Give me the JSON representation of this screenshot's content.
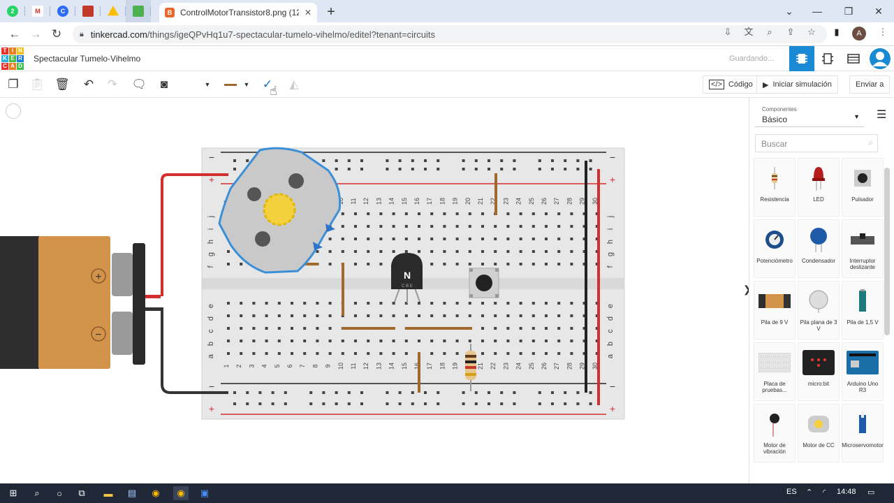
{
  "browser": {
    "active_tab_title": "ControlMotorTransistor8.png (12",
    "url_domain": "tinkercad.com",
    "url_path": "/things/igeQPvHq1u7-spectacular-tumelo-vihelmo/editel?tenant=circuits",
    "avatar_letter": "A",
    "whatsapp_badge": "2"
  },
  "app": {
    "logo_letters": [
      "T",
      "I",
      "N",
      "K",
      "E",
      "R",
      "C",
      "A",
      "D"
    ],
    "project_title": "Spectacular Tumelo-Vihelmo",
    "status": "Guardando..."
  },
  "toolbar": {
    "code_label": "Código",
    "simulate_label": "Iniciar simulación",
    "send_label": "Enviar a"
  },
  "panel": {
    "components_label": "Componentes",
    "components_value": "Básico",
    "search_placeholder": "Buscar",
    "items": [
      {
        "label": "Resistencia",
        "icon": "resistor-icon"
      },
      {
        "label": "LED",
        "icon": "led-icon"
      },
      {
        "label": "Pulsador",
        "icon": "pushbutton-icon"
      },
      {
        "label": "Potenciómetro",
        "icon": "potentiometer-icon"
      },
      {
        "label": "Condensador",
        "icon": "capacitor-icon"
      },
      {
        "label": "Interruptor deslizante",
        "icon": "slide-switch-icon"
      },
      {
        "label": "Pila de 9 V",
        "icon": "battery-9v-icon"
      },
      {
        "label": "Pila plana de 3 V",
        "icon": "coin-cell-icon"
      },
      {
        "label": "Pila de 1,5 V",
        "icon": "battery-aa-icon"
      },
      {
        "label": "Placa de pruebas...",
        "icon": "breadboard-icon"
      },
      {
        "label": "micro:bit",
        "icon": "microbit-icon"
      },
      {
        "label": "Arduino Uno R3",
        "icon": "arduino-icon"
      },
      {
        "label": "Motor de vibración",
        "icon": "vibration-motor-icon"
      },
      {
        "label": "Motor de CC",
        "icon": "dc-motor-icon"
      },
      {
        "label": "Microservomotor",
        "icon": "servo-icon"
      }
    ]
  },
  "breadboard": {
    "column_numbers": [
      "1",
      "2",
      "3",
      "4",
      "5",
      "6",
      "7",
      "8",
      "9",
      "10",
      "11",
      "12",
      "13",
      "14",
      "15",
      "16",
      "17",
      "18",
      "19",
      "20",
      "21",
      "22",
      "23",
      "24",
      "25",
      "26",
      "27",
      "28",
      "29",
      "30"
    ],
    "top_rows": [
      "j",
      "i",
      "h",
      "g",
      "f"
    ],
    "bottom_rows": [
      "e",
      "d",
      "c",
      "b",
      "a"
    ],
    "rail_minus": "−",
    "rail_plus": "+",
    "transistor_label": "N",
    "transistor_pins": "C B E"
  },
  "battery": {
    "plus": "+",
    "minus": "−"
  },
  "taskbar": {
    "lang": "ES",
    "time": "14:48"
  }
}
